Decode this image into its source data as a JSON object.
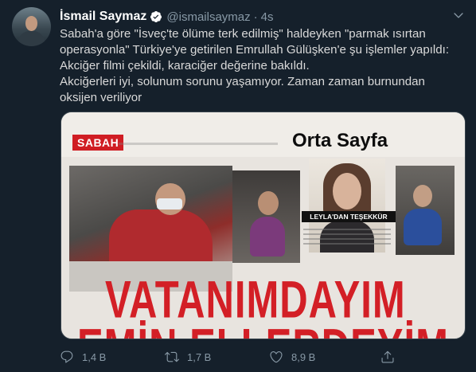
{
  "tweet": {
    "author_name": "İsmail Saymaz",
    "handle": "@ismailsaymaz",
    "separator": "·",
    "time": "4s",
    "paragraphs": [
      "Sabah'a göre \"İsveç'te ölüme terk edilmiş\" haldeyken \"parmak ısırtan operasyonla\" Türkiye'ye getirilen Emrullah Gülüşken'e şu işlemler yapıldı:",
      "Akciğer filmi çekildi, karaciğer değerine bakıldı.",
      "Akciğerleri iyi, solunum sorunu yaşamıyor. Zaman zaman burnundan oksijen veriliyor"
    ],
    "photo_text": {
      "masthead": "SABAH",
      "section": "Orta Sayfa",
      "caption": "LEYLA'DAN TEŞEKKÜR",
      "headline_1": "VATANIMDAYIM",
      "headline_2": "EMİN ELLERDEYİM"
    },
    "actions": {
      "reply_count": "",
      "retweet_count": "1,4 B",
      "like_count": "1,7 B",
      "views_count": "8,9 B"
    }
  },
  "icons": {
    "verified": "verified-badge-icon",
    "more": "chevron-down-icon",
    "reply": "reply-icon",
    "retweet": "retweet-icon",
    "like": "heart-icon",
    "share": "share-icon"
  },
  "colors": {
    "background": "#15202b",
    "text": "#d9d9d9",
    "muted": "#8899a6",
    "accent": "#1da1f2",
    "headline_red": "#d31f26"
  }
}
